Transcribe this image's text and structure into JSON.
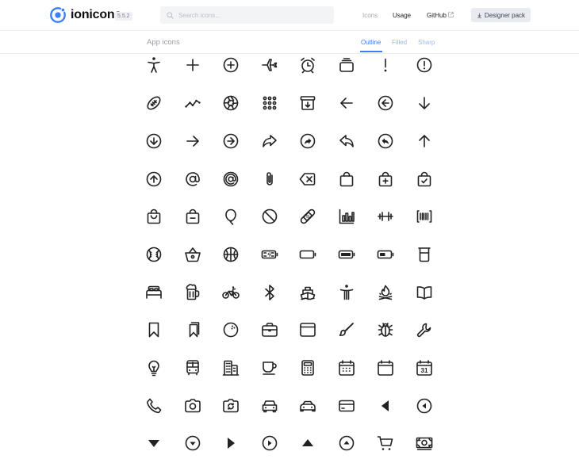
{
  "header": {
    "brand": "ionicons",
    "version": "5.5.2",
    "search_placeholder": "Search icons...",
    "nav": {
      "icons": "Icons",
      "usage": "Usage",
      "github": "GitHub",
      "designer_pack": "Designer pack"
    }
  },
  "subheader": {
    "title": "App icons",
    "tabs": [
      "Outline",
      "Filled",
      "Sharp"
    ],
    "active_tab": "Outline"
  },
  "colors": {
    "accent": "#3a7ff6",
    "icon": "#222222",
    "muted": "#9aa0ab"
  },
  "icons": [
    [
      "accessibility-icon",
      "add-icon",
      "add-circle-icon",
      "airplane-icon",
      "alarm-icon",
      "albums-icon",
      "alert-icon",
      "alert-circle-icon"
    ],
    [
      "american-football-icon",
      "analytics-icon",
      "aperture-icon",
      "apps-icon",
      "archive-icon",
      "arrow-back-icon",
      "arrow-back-circle-icon",
      "arrow-down-icon"
    ],
    [
      "arrow-down-circle-icon",
      "arrow-forward-icon",
      "arrow-forward-circle-icon",
      "arrow-redo-icon",
      "arrow-redo-circle-icon",
      "arrow-undo-icon",
      "arrow-undo-circle-icon",
      "arrow-up-icon"
    ],
    [
      "arrow-up-circle-icon",
      "at-icon",
      "at-circle-icon",
      "attach-icon",
      "backspace-icon",
      "bag-icon",
      "bag-add-icon",
      "bag-check-icon"
    ],
    [
      "bag-handle-icon",
      "bag-remove-icon",
      "balloon-icon",
      "ban-icon",
      "bandage-icon",
      "bar-chart-icon",
      "barbell-icon",
      "barcode-icon"
    ],
    [
      "baseball-icon",
      "basket-icon",
      "basketball-icon",
      "battery-charging-icon",
      "battery-dead-icon",
      "battery-full-icon",
      "battery-half-icon",
      "beaker-icon"
    ],
    [
      "bed-icon",
      "beer-icon",
      "bicycle-icon",
      "bluetooth-icon",
      "boat-icon",
      "body-icon",
      "bonfire-icon",
      "book-icon"
    ],
    [
      "bookmark-icon",
      "bookmarks-icon",
      "bowling-ball-icon",
      "briefcase-icon",
      "browsers-icon",
      "brush-icon",
      "bug-icon",
      "build-icon"
    ],
    [
      "bulb-icon",
      "bus-icon",
      "business-icon",
      "cafe-icon",
      "calculator-icon",
      "calendar-icon",
      "calendar-clear-icon",
      "calendar-number-icon"
    ],
    [
      "call-icon",
      "camera-icon",
      "camera-reverse-icon",
      "car-icon",
      "car-sport-icon",
      "card-icon",
      "caret-back-icon",
      "caret-back-circle-icon"
    ],
    [
      "caret-down-icon",
      "caret-down-circle-icon",
      "caret-forward-icon",
      "caret-forward-circle-icon",
      "caret-up-icon",
      "caret-up-circle-icon",
      "cart-icon",
      "cash-icon"
    ]
  ],
  "calendar_number_text": "31"
}
